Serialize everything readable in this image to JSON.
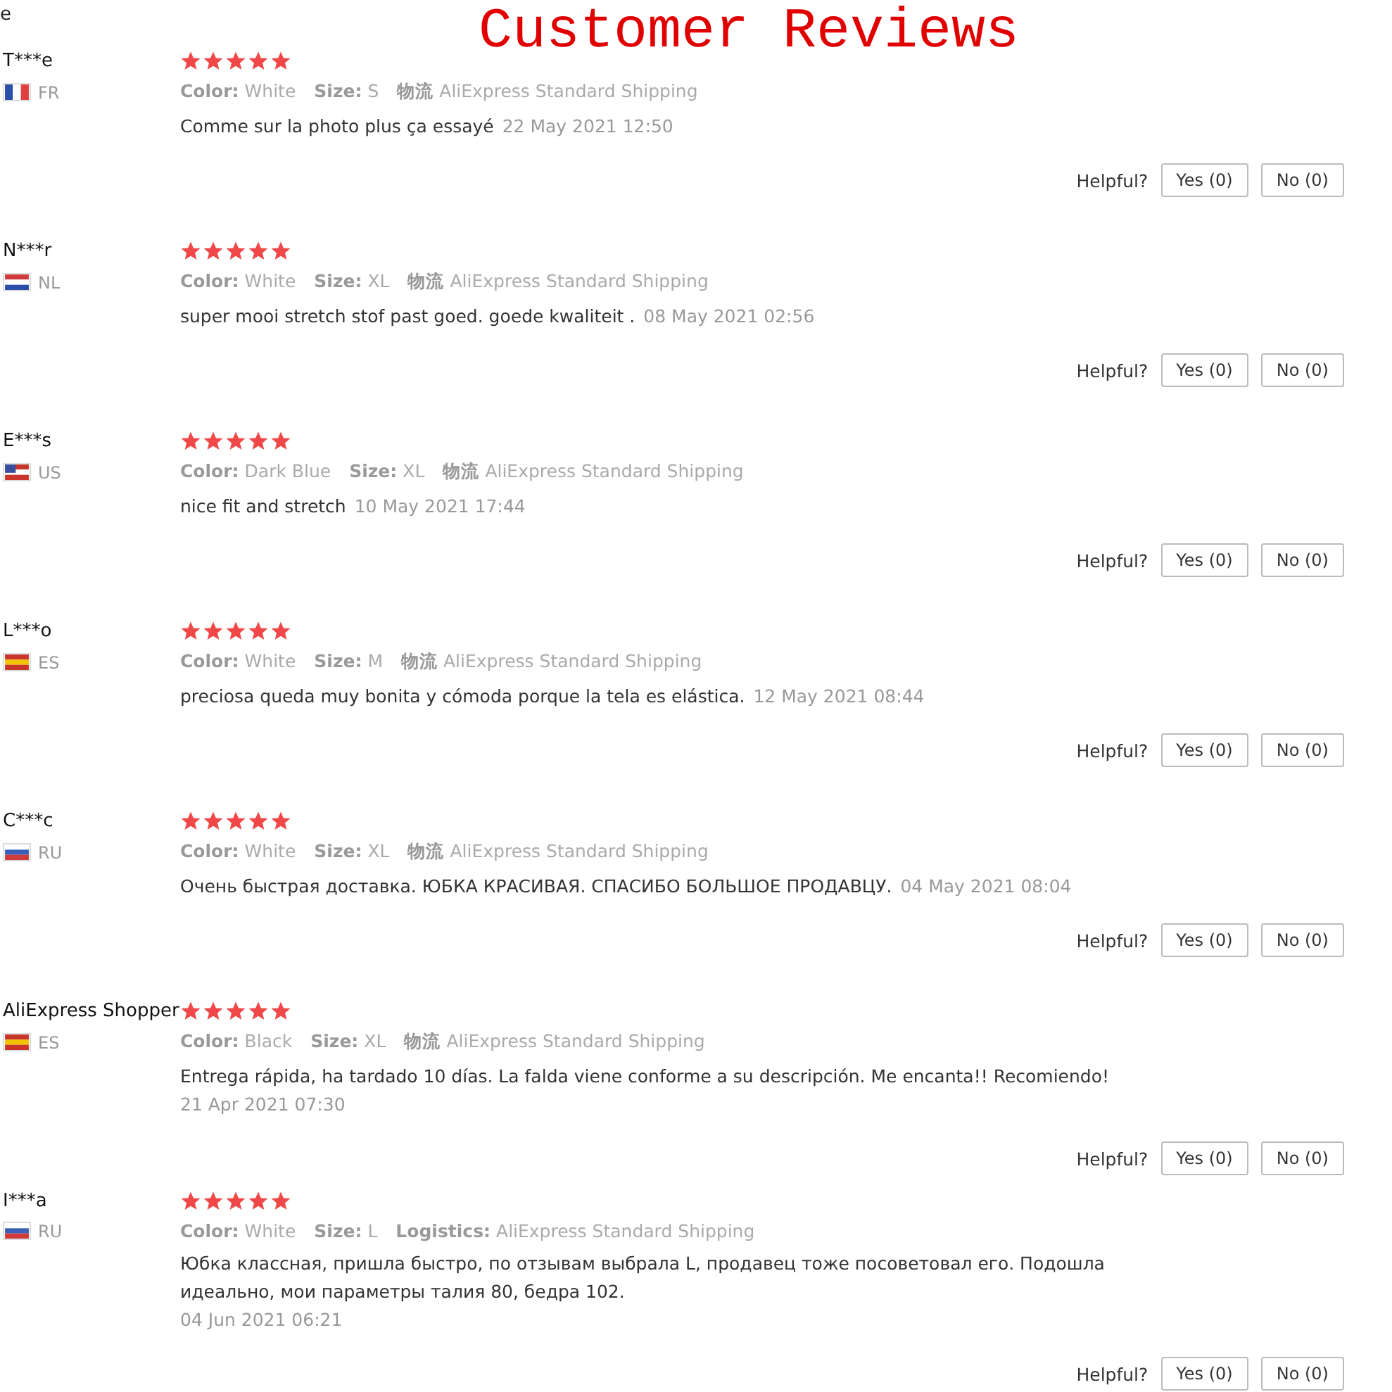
{
  "top_fragment": "e",
  "title": "Customer Reviews",
  "reviews": [
    {
      "name": "T***e",
      "flag": {
        "kind": "vertical",
        "bands": [
          {
            "color": "#2b4ea8"
          },
          {
            "color": "#ffffff"
          },
          {
            "color": "#e04040"
          }
        ]
      },
      "country": "FR",
      "stars": 5,
      "attributes": [
        {
          "label": "Color:",
          "value": "White"
        },
        {
          "label": "Size:",
          "value": "S"
        },
        {
          "label": "物流",
          "value": "AliExpress Standard Shipping"
        }
      ],
      "comment": "Comme sur la photo plus ça essayé",
      "date": "22 May 2021 12:50",
      "helpful": "Helpful?",
      "yes": "Yes (0)",
      "no": "No (0)"
    },
    {
      "name": "N***r",
      "flag": {
        "kind": "horizontal",
        "bands": [
          {
            "color": "#d03a3a"
          },
          {
            "color": "#ffffff"
          },
          {
            "color": "#2b4ea8"
          }
        ]
      },
      "country": "NL",
      "stars": 5,
      "attributes": [
        {
          "label": "Color:",
          "value": "White"
        },
        {
          "label": "Size:",
          "value": "XL"
        },
        {
          "label": "物流",
          "value": "AliExpress Standard Shipping"
        }
      ],
      "comment": "super mooi stretch stof past goed. goede kwaliteit .",
      "date": "08 May 2021 02:56",
      "helpful": "Helpful?",
      "yes": "Yes (0)",
      "no": "No (0)"
    },
    {
      "name": "E***s",
      "flag": {
        "kind": "canton",
        "bands": [
          {
            "color": "#c8352b"
          },
          {
            "color": "#ffffff"
          },
          {
            "color": "#c8352b"
          },
          {
            "color": "#3a4f9e"
          }
        ]
      },
      "country": "US",
      "stars": 5,
      "attributes": [
        {
          "label": "Color:",
          "value": "Dark Blue"
        },
        {
          "label": "Size:",
          "value": "XL"
        },
        {
          "label": "物流",
          "value": "AliExpress Standard Shipping"
        }
      ],
      "comment": "nice fit and stretch",
      "date": "10 May 2021 17:44",
      "helpful": "Helpful?",
      "yes": "Yes (0)",
      "no": "No (0)"
    },
    {
      "name": "L***o",
      "flag": {
        "kind": "horizontal",
        "bands": [
          {
            "color": "#c8352b"
          },
          {
            "color": "#f2c300"
          },
          {
            "color": "#c8352b"
          }
        ]
      },
      "country": "ES",
      "stars": 5,
      "attributes": [
        {
          "label": "Color:",
          "value": "White"
        },
        {
          "label": "Size:",
          "value": "M"
        },
        {
          "label": "物流",
          "value": "AliExpress Standard Shipping"
        }
      ],
      "comment": "preciosa queda muy bonita y cómoda porque la tela es elástica.",
      "date": "12 May 2021 08:44",
      "helpful": "Helpful?",
      "yes": "Yes (0)",
      "no": "No (0)"
    },
    {
      "name": "C***c",
      "flag": {
        "kind": "horizontal",
        "bands": [
          {
            "color": "#ffffff"
          },
          {
            "color": "#3a5fb8"
          },
          {
            "color": "#d03a3a"
          }
        ]
      },
      "country": "RU",
      "stars": 5,
      "attributes": [
        {
          "label": "Color:",
          "value": "White"
        },
        {
          "label": "Size:",
          "value": "XL"
        },
        {
          "label": "物流",
          "value": "AliExpress Standard Shipping"
        }
      ],
      "comment": "Очень быстрая доставка. ЮБКА КРАСИВАЯ. СПАСИБО БОЛЬШОЕ ПРОДАВЦУ.",
      "date": "04 May 2021 08:04",
      "helpful": "Helpful?",
      "yes": "Yes (0)",
      "no": "No (0)"
    },
    {
      "name": "AliExpress Shopper",
      "flag": {
        "kind": "horizontal",
        "bands": [
          {
            "color": "#c8352b"
          },
          {
            "color": "#f2c300"
          },
          {
            "color": "#c8352b"
          }
        ]
      },
      "country": "ES",
      "stars": 5,
      "attributes": [
        {
          "label": "Color:",
          "value": "Black"
        },
        {
          "label": "Size:",
          "value": "XL"
        },
        {
          "label": "物流",
          "value": "AliExpress Standard Shipping"
        }
      ],
      "comment": "Entrega rápida, ha tardado 10 días. La falda viene conforme a su descripción. Me encanta!! Recomiendo!",
      "date": "21 Apr 2021 07:30",
      "helpful": "Helpful?",
      "yes": "Yes (0)",
      "no": "No (0)"
    },
    {
      "name": "I***a",
      "flag": {
        "kind": "horizontal",
        "bands": [
          {
            "color": "#ffffff"
          },
          {
            "color": "#3a5fb8"
          },
          {
            "color": "#d03a3a"
          }
        ]
      },
      "country": "RU",
      "stars": 5,
      "attributes": [
        {
          "label": "Color:",
          "value": "White"
        },
        {
          "label": "Size:",
          "value": "L"
        },
        {
          "label": "Logistics:",
          "value": "AliExpress Standard Shipping"
        }
      ],
      "comment": "Юбка классная, пришла быстро, по отзывам выбрала L, продавец тоже посоветовал его. Подошла идеально, мои параметры талия 80, бедра 102.",
      "date": "04 Jun 2021 06:21",
      "helpful": "Helpful?",
      "yes": "Yes (0)",
      "no": "No (0)"
    }
  ]
}
